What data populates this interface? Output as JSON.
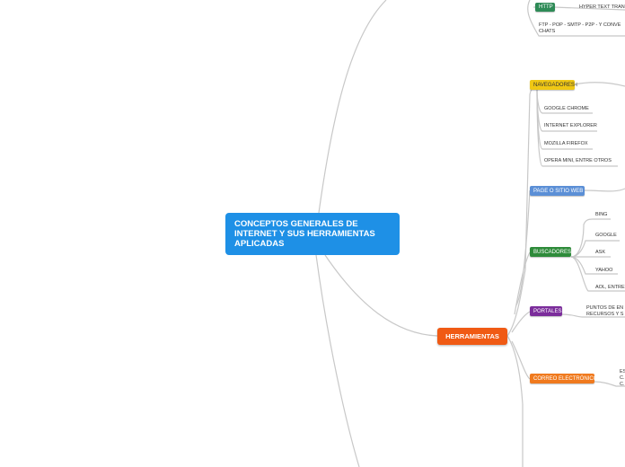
{
  "central": {
    "title": "CONCEPTOS GENERALES DE INTERNET Y SUS HERRAMIENTAS APLICADAS"
  },
  "herramientas": {
    "label": "HERRAMIENTAS"
  },
  "http": {
    "label": "HTTP",
    "leaf": "HYPER TEXT TRAN",
    "color": "#2e8b57"
  },
  "ftp_leaf": {
    "line1": "FTP - POP - SMTP - P2P - Y CONVE",
    "line2": "CHATS"
  },
  "navegadores": {
    "label": "NAVEGADORES",
    "color": "#f0c814",
    "items": [
      "GOOGLE CHROME",
      "INTERNET EXPLORER",
      "MOZILLA FIREFOX",
      "OPERA MINI, ENTRE OTROS"
    ]
  },
  "page": {
    "label": "PAGE O SITIO WEB",
    "color": "#5b8fd6"
  },
  "buscadores": {
    "label": "BUSCADORES",
    "color": "#2e8b3a",
    "items": [
      "BING",
      "GOOGLE",
      "ASK",
      "YAHOO",
      "AOL, ENTRE"
    ]
  },
  "portales": {
    "label": "PORTALES",
    "color": "#7b2d9b",
    "leaf1": "PUNTOS DE EN",
    "leaf2": "RECURSOS Y S"
  },
  "correo": {
    "label": "CORREO ELECTRÓNICO",
    "color": "#f07a1e",
    "leaf1": "ES",
    "leaf2": "C.",
    "leaf3": "C."
  }
}
